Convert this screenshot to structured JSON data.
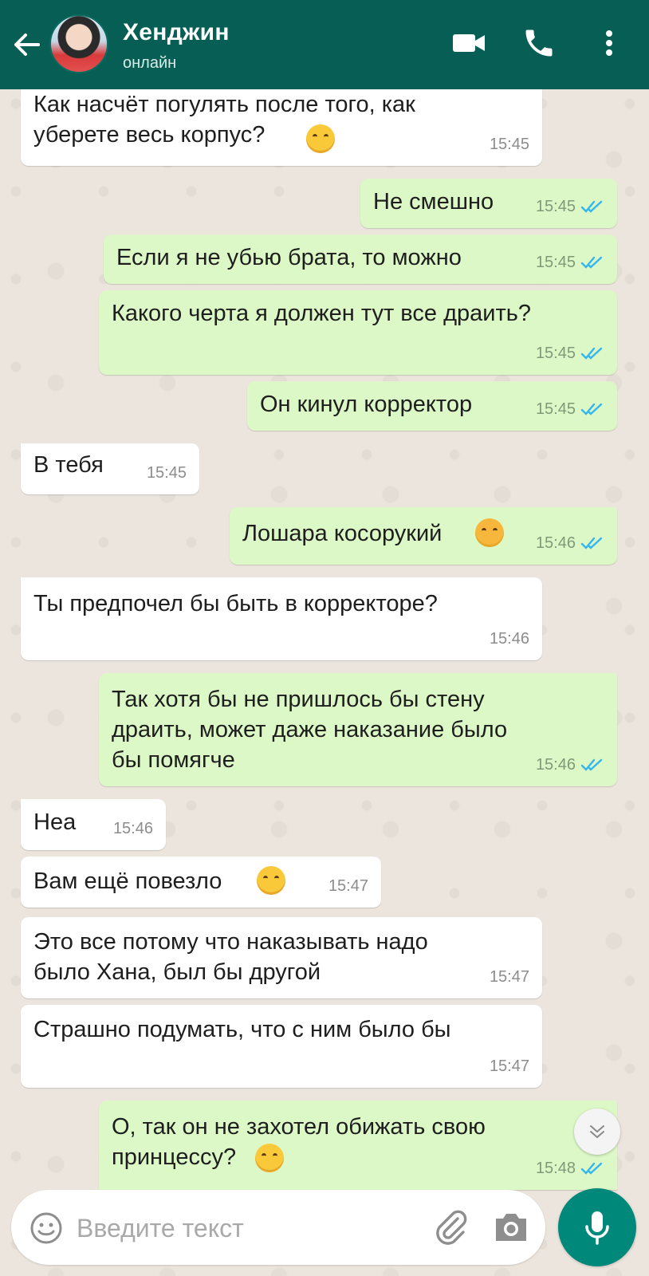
{
  "header": {
    "contact_name": "Хенджин",
    "status": "онлайн"
  },
  "colors": {
    "header": "#075e54",
    "outgoing_bubble": "#dcf8c6",
    "incoming_bubble": "#ffffff",
    "read_ticks": "#34b7f1",
    "mic_button": "#00897b"
  },
  "messages": [
    {
      "direction": "in",
      "text": "Как насчёт погулять после того, как\nуберете весь корпус?",
      "emoji": "joy",
      "time": "15:45"
    },
    {
      "direction": "out",
      "text": "Не смешно",
      "time": "15:45",
      "read": true
    },
    {
      "direction": "out",
      "text": "Если я не убью брата, то можно",
      "time": "15:45",
      "read": true
    },
    {
      "direction": "out",
      "text": "Какого черта я должен тут все драить?",
      "time": "15:45",
      "read": true
    },
    {
      "direction": "out",
      "text": "Он кинул корректор",
      "time": "15:45",
      "read": true
    },
    {
      "direction": "in",
      "text": "В тебя",
      "time": "15:45"
    },
    {
      "direction": "out",
      "text": "Лошара косорукий",
      "emoji": "triumph",
      "time": "15:46",
      "read": true
    },
    {
      "direction": "in",
      "text": "Ты предпочел бы быть в корректоре?",
      "time": "15:46"
    },
    {
      "direction": "out",
      "text": "Так хотя бы не пришлось бы стену\nдраить, может даже наказание было\nбы помягче",
      "time": "15:46",
      "read": true
    },
    {
      "direction": "in",
      "text": "Неа",
      "time": "15:46"
    },
    {
      "direction": "in",
      "text": "Вам ещё повезло ",
      "emoji": "joy",
      "time": "15:47"
    },
    {
      "direction": "in",
      "text": "Это все потому что наказывать надо\nбыло Хана, был бы другой",
      "time": "15:47"
    },
    {
      "direction": "in",
      "text": "Страшно подумать, что с ним было бы",
      "time": "15:47"
    },
    {
      "direction": "out",
      "text": "О, так он не захотел обижать свою\nпринцессу?",
      "emoji": "relieved",
      "time": "15:48",
      "read": true
    }
  ],
  "composer": {
    "placeholder": "Введите текст"
  },
  "icons": [
    "back-arrow-icon",
    "video-call-icon",
    "phone-icon",
    "more-vert-icon",
    "smiley-icon",
    "paperclip-icon",
    "camera-icon",
    "mic-icon",
    "chevron-down-icon",
    "double-check-icon"
  ]
}
